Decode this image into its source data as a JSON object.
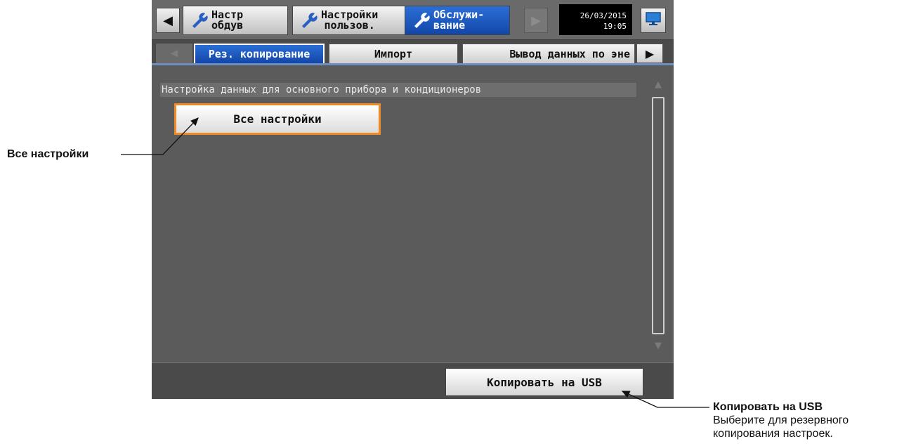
{
  "menubar": {
    "items": [
      {
        "label": "Настр\nобдув",
        "active": false
      },
      {
        "label": "Настройки\nпользов.",
        "active": false
      },
      {
        "label": "Обслужи-\nвание",
        "active": true
      }
    ],
    "date": "26/03/2015",
    "time": "19:05",
    "icons": [
      "arrow-left-icon",
      "wrench-icon",
      "arrow-right-icon",
      "monitor-icon"
    ]
  },
  "tabs": {
    "items": [
      {
        "label": "Рез. копирование",
        "active": true
      },
      {
        "label": "Импорт",
        "active": false
      },
      {
        "label": "Вывод данных по эне",
        "active": false
      }
    ]
  },
  "content": {
    "section_header": "Настройка данных для основного прибора и кондиционеров",
    "all_settings_button": "Все настройки"
  },
  "bottom": {
    "copy_usb_button": "Копировать на USB"
  },
  "annotations": {
    "left_label": "Все настройки",
    "right_title": "Копировать на USB",
    "right_desc_line1": "Выберите для резервного",
    "right_desc_line2": "копирования настроек."
  },
  "colors": {
    "active_blue": "#1d5cc4",
    "highlight_orange": "#f08a24",
    "panel_gray": "#5b5b5b"
  }
}
